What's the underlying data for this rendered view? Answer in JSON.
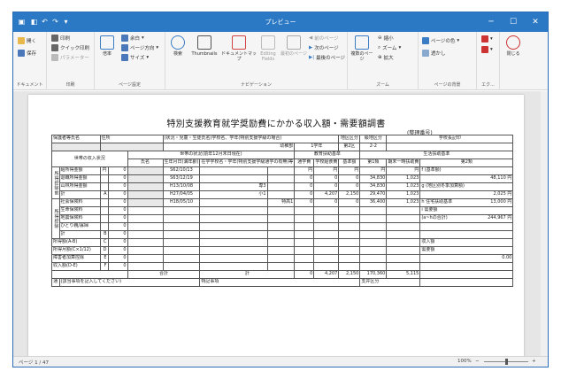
{
  "window": {
    "title": "プレビュー",
    "minimize": "─",
    "maximize": "☐",
    "close": "✕"
  },
  "ribbon": {
    "groups": [
      {
        "label": "ドキュメント",
        "items": [
          "開く",
          "保存"
        ]
      },
      {
        "label": "印刷",
        "items": [
          "印刷",
          "クイック印刷",
          "パラメーター"
        ]
      },
      {
        "label": "ページ設定",
        "items": [
          "余白",
          "ページ方向",
          "サイズ",
          "倍率"
        ]
      },
      {
        "label": "ナビゲーション",
        "items": [
          "検索",
          "Thumbnails",
          "ドキュメントマップ",
          "Editing Fields",
          "最初のページ",
          "前のページ",
          "次のページ",
          "最後のページ"
        ]
      },
      {
        "label": "ズーム",
        "items": [
          "複数のページ",
          "縮小",
          "ズーム",
          "拡大"
        ]
      },
      {
        "label": "ページの背景",
        "items": [
          "ページの色",
          "透かし"
        ]
      },
      {
        "label": "エク...",
        "items": [
          "エク..."
        ]
      },
      {
        "label": "",
        "items": [
          "閉じる"
        ]
      }
    ]
  },
  "status": {
    "page": "ページ 1 / 47",
    "zoom": "100%"
  },
  "form": {
    "title": "特別支援教育就学奨励費にかかる収入額・需要額調書",
    "seiri": "(整理番号)",
    "header": {
      "guardian": "保護者等氏名",
      "address": "住所",
      "status": "(状況・児童・生徒氏名)学校名、学年(特別支援学級の場合)",
      "school_dept": "幼稚部",
      "grade": "1学年",
      "area_label": "地区区分",
      "area_value": "第2区",
      "amount_label": "級地区分",
      "amount_value": "2-2",
      "school_code": "学校長記印"
    },
    "section": {
      "setai": "世帯の状況(前年12月末日現在)",
      "kyoiku": "教育扶助基準",
      "seikatsu": "生活扶助基準",
      "juyo": "需要額",
      "income": "世帯の収入状況",
      "name": "氏名",
      "birth": "生年月日(満年齢)",
      "school": "在学学校名・学年(特別支援学級通学の有無)等",
      "tsugaku": "通学費",
      "kyushoku": "学校給食費",
      "kijun": "基準額",
      "dai1": "第1類",
      "ki_kasan": "期末一時扶助費",
      "dai2": "第2類"
    },
    "rows": [
      {
        "label": "給所得金額",
        "mark": "円",
        "val": "0",
        "blur": "",
        "birth": "S62/10/13",
        "age": "(35才)",
        "col1": "",
        "col2": "",
        "tsugaku": "円",
        "kyushoku": "円",
        "kijun": "円",
        "dai1": "円",
        "ki": "円",
        "right": "f (基準額)",
        "rightv": ""
      },
      {
        "label": "退職所得金額",
        "mark": "",
        "val": "0",
        "blur": "",
        "birth": "S63/12/19",
        "age": "(34才)",
        "col1": "",
        "col2": "",
        "tsugaku": "0",
        "kyushoku": "0",
        "kijun": "0",
        "dai1": "34,830",
        "ki": "1,023",
        "right": "",
        "rightv": "48,110 円"
      },
      {
        "label": "山林所得金額",
        "mark": "",
        "val": "0",
        "blur": "",
        "birth": "H13/10/08",
        "age": "(21才)",
        "col1": "専3",
        "col2": "",
        "tsugaku": "0",
        "kyushoku": "0",
        "kijun": "0",
        "dai1": "34,830",
        "ki": "1,023",
        "right": "g (地区別冬季加算額)",
        "rightv": ""
      },
      {
        "label": "計",
        "mark": "A",
        "val": "0",
        "blur": "",
        "birth": "H27/04/05",
        "age": "(7才)",
        "col1": "小1",
        "col2": "",
        "tsugaku": "0",
        "kyushoku": "4,207",
        "kijun": "2,150",
        "dai1": "29,470",
        "ki": "1,023",
        "right": "",
        "rightv": "2,025 円"
      },
      {
        "label": "社会保険料",
        "mark": "",
        "val": "0",
        "blur": "",
        "birth": "H18/05/10",
        "age": "(16才)",
        "col1": "",
        "col2": "特高1",
        "tsugaku": "0",
        "kyushoku": "0",
        "kijun": "0",
        "dai1": "36,400",
        "ki": "1,023",
        "right": "h 住宅扶助基準",
        "rightv": "13,000 円"
      },
      {
        "label": "生命保険料",
        "mark": "",
        "val": "0",
        "blur": "",
        "birth": "",
        "age": "",
        "col1": "",
        "col2": "",
        "tsugaku": "",
        "kyushoku": "",
        "kijun": "",
        "dai1": "",
        "ki": "",
        "right": "i 需要額",
        "rightv": ""
      },
      {
        "label": "地震保険料",
        "mark": "",
        "val": "0",
        "blur": "",
        "birth": "",
        "age": "",
        "col1": "",
        "col2": "",
        "tsugaku": "",
        "kyushoku": "",
        "kijun": "",
        "dai1": "",
        "ki": "",
        "right": "(a~hの合計)",
        "rightv": "244,967 円"
      },
      {
        "label": "ひとり親/寡婦",
        "mark": "",
        "val": "0",
        "blur": "",
        "birth": "",
        "age": "",
        "col1": "",
        "col2": "",
        "tsugaku": "",
        "kyushoku": "",
        "kijun": "",
        "dai1": "",
        "ki": "",
        "right": "",
        "rightv": ""
      },
      {
        "label": "計",
        "mark": "B",
        "val": "0",
        "blur": "",
        "birth": "",
        "age": "",
        "col1": "",
        "col2": "",
        "tsugaku": "",
        "kyushoku": "",
        "kijun": "",
        "dai1": "",
        "ki": "",
        "right": "",
        "rightv": ""
      },
      {
        "label": "所得額(A-B)",
        "mark": "C",
        "val": "0",
        "blur": "",
        "birth": "",
        "age": "",
        "col1": "",
        "col2": "",
        "tsugaku": "",
        "kyushoku": "",
        "kijun": "",
        "dai1": "",
        "ki": "",
        "right": "収入額",
        "rightv": ""
      },
      {
        "label": "所得月額(C×1/12)",
        "mark": "D",
        "val": "0",
        "blur": "",
        "birth": "",
        "age": "",
        "col1": "",
        "col2": "",
        "tsugaku": "",
        "kyushoku": "",
        "kijun": "",
        "dai1": "",
        "ki": "",
        "right": "需要額",
        "rightv": ""
      },
      {
        "label": "障害者加算控除",
        "mark": "E",
        "val": "0",
        "blur": "",
        "birth": "",
        "age": "",
        "col1": "",
        "col2": "",
        "tsugaku": "",
        "kyushoku": "",
        "kijun": "",
        "dai1": "",
        "ki": "",
        "right": "",
        "rightv": "0.00"
      },
      {
        "label": "収入額(D-E)",
        "mark": "F",
        "val": "0",
        "blur": "",
        "birth": "",
        "age": "",
        "col1": "",
        "col2": "",
        "tsugaku": "",
        "kyushoku": "",
        "kijun": "",
        "dai1": "",
        "ki": "",
        "right": "",
        "rightv": ""
      }
    ],
    "total_row": {
      "label": "合計",
      "kei": "計",
      "tsugaku": "0",
      "kyushoku": "4,207",
      "kijun": "2,150",
      "dai1": "170,360",
      "ki": "5,115"
    },
    "bottom": {
      "tsushin": "通",
      "note": "(該当事項を記入してください)",
      "tokki": "特記事項",
      "shien": "支弁区分"
    },
    "side_labels": {
      "shotoku_kojo": "所得控除前",
      "shotoku_kojo2": "所得控除"
    }
  }
}
